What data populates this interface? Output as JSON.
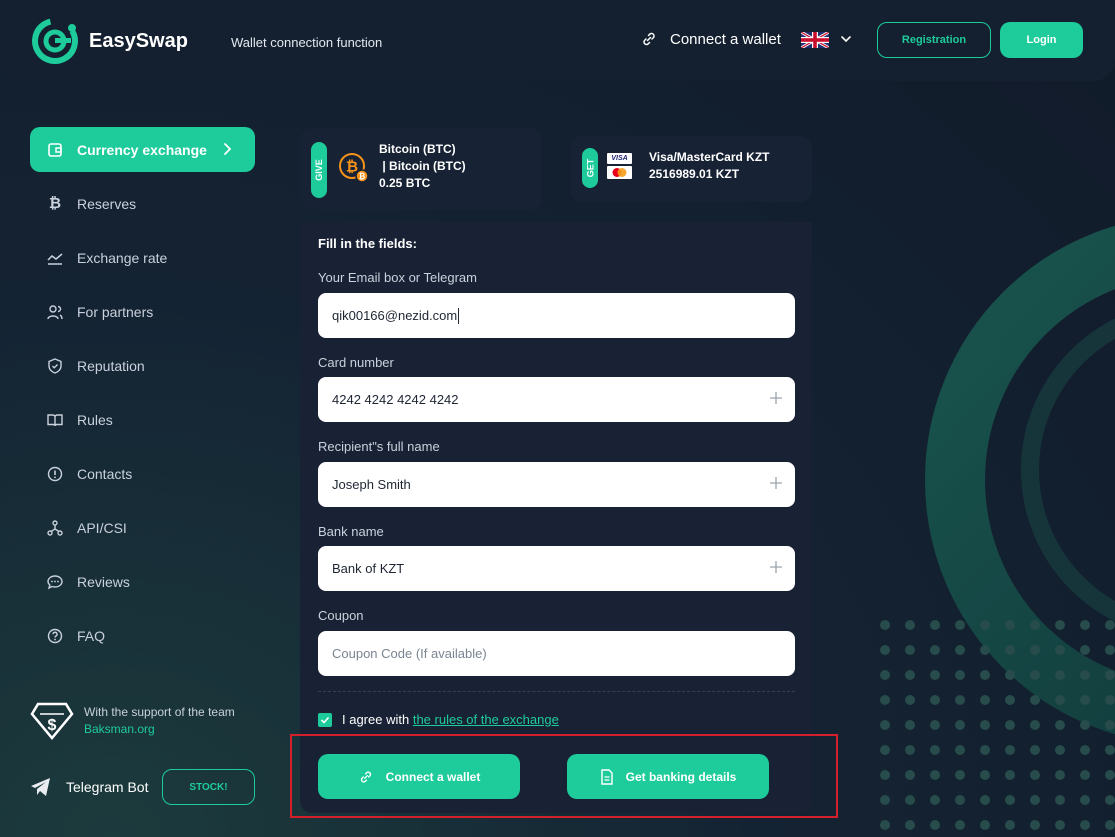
{
  "header": {
    "brand": "EasySwap",
    "tagline": "Wallet connection function",
    "connect_wallet_label": "Connect a wallet",
    "registration_label": "Registration",
    "login_label": "Login"
  },
  "sidebar": {
    "items": [
      {
        "label": "Currency exchange",
        "icon": "exchange-icon"
      },
      {
        "label": "Reserves",
        "icon": "bitcoin-icon"
      },
      {
        "label": "Exchange rate",
        "icon": "chart-icon"
      },
      {
        "label": "For partners",
        "icon": "users-icon"
      },
      {
        "label": "Reputation",
        "icon": "shield-icon"
      },
      {
        "label": "Rules",
        "icon": "book-icon"
      },
      {
        "label": "Contacts",
        "icon": "info-icon"
      },
      {
        "label": "API/CSI",
        "icon": "api-icon"
      },
      {
        "label": "Reviews",
        "icon": "chat-icon"
      },
      {
        "label": "FAQ",
        "icon": "question-icon"
      }
    ],
    "support_text": "With the support of the team",
    "support_link": "Baksman.org",
    "telegram_label": "Telegram Bot",
    "stock_label": "STOCK!"
  },
  "give": {
    "tag": "GIVE",
    "line1": "Bitcoin (BTC)",
    "line2": " | Bitcoin (BTC)",
    "amount": "0.25 BTC"
  },
  "get": {
    "tag": "GET",
    "name": "Visa/MasterCard KZT",
    "amount": "2516989.01 KZT",
    "visa_text": "VISA"
  },
  "form": {
    "title": "Fill in the fields:",
    "email_label": "Your Email box or Telegram",
    "email_value": "qik00166@nezid.com",
    "card_label": "Card number",
    "card_value": "4242 4242 4242 4242",
    "name_label": "Recipient\"s full name",
    "name_value": "Joseph Smith",
    "bank_label": "Bank name",
    "bank_value": "Bank of KZT",
    "coupon_label": "Coupon",
    "coupon_placeholder": "Coupon Code (If available)",
    "agree_prefix": "I agree with",
    "agree_link": "the rules of the exchange",
    "connect_button": "Connect a wallet",
    "banking_button": "Get banking details"
  },
  "colors": {
    "accent": "#1ecb9b",
    "panel": "#182234",
    "highlight": "#d4202a"
  }
}
